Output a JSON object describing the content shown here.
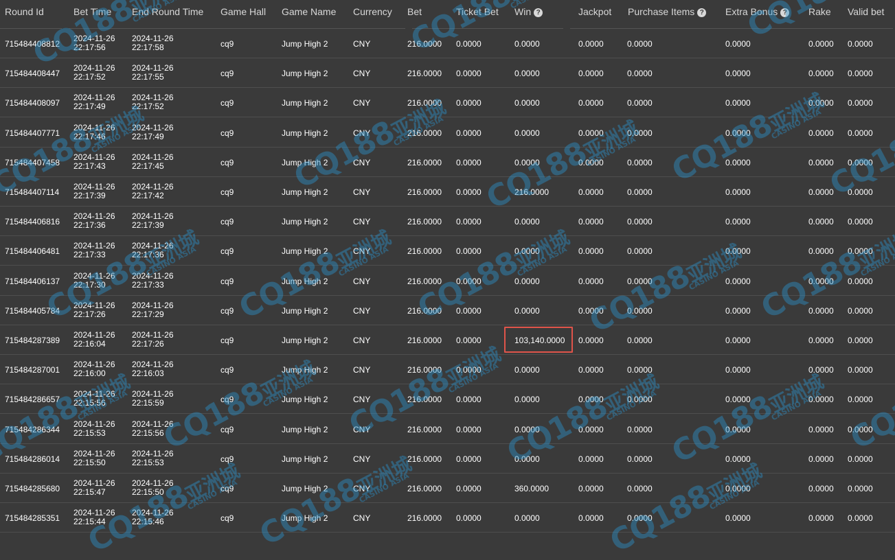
{
  "columns": [
    {
      "label": "Round Id",
      "help": false
    },
    {
      "label": "Bet Time",
      "help": false
    },
    {
      "label": "End Round Time",
      "help": false
    },
    {
      "label": "Game Hall",
      "help": false
    },
    {
      "label": "Game Name",
      "help": false
    },
    {
      "label": "Currency",
      "help": false
    },
    {
      "label": "Bet",
      "help": false
    },
    {
      "label": "Ticket Bet",
      "help": false
    },
    {
      "label": "Win",
      "help": true
    },
    {
      "label": "Jackpot",
      "help": false
    },
    {
      "label": "Purchase Items",
      "help": true
    },
    {
      "label": "Extra Bonus",
      "help": true
    },
    {
      "label": "Rake",
      "help": false
    },
    {
      "label": "Valid bet",
      "help": false
    }
  ],
  "help_glyph": "?",
  "rows": [
    {
      "round_id": "715484408812",
      "bet_date": "2024-11-26",
      "bet_time": "22:17:56",
      "end_date": "2024-11-26",
      "end_time": "22:17:58",
      "hall": "cq9",
      "game": "Jump High 2",
      "currency": "CNY",
      "bet": "216.0000",
      "ticket_bet": "0.0000",
      "win": "0.0000",
      "jackpot": "0.0000",
      "purchase": "0.0000",
      "extra_bonus": "0.0000",
      "rake": "0.0000",
      "valid_bet": "0.0000"
    },
    {
      "round_id": "715484408447",
      "bet_date": "2024-11-26",
      "bet_time": "22:17:52",
      "end_date": "2024-11-26",
      "end_time": "22:17:55",
      "hall": "cq9",
      "game": "Jump High 2",
      "currency": "CNY",
      "bet": "216.0000",
      "ticket_bet": "0.0000",
      "win": "0.0000",
      "jackpot": "0.0000",
      "purchase": "0.0000",
      "extra_bonus": "0.0000",
      "rake": "0.0000",
      "valid_bet": "0.0000"
    },
    {
      "round_id": "715484408097",
      "bet_date": "2024-11-26",
      "bet_time": "22:17:49",
      "end_date": "2024-11-26",
      "end_time": "22:17:52",
      "hall": "cq9",
      "game": "Jump High 2",
      "currency": "CNY",
      "bet": "216.0000",
      "ticket_bet": "0.0000",
      "win": "0.0000",
      "jackpot": "0.0000",
      "purchase": "0.0000",
      "extra_bonus": "0.0000",
      "rake": "0.0000",
      "valid_bet": "0.0000"
    },
    {
      "round_id": "715484407771",
      "bet_date": "2024-11-26",
      "bet_time": "22:17:46",
      "end_date": "2024-11-26",
      "end_time": "22:17:49",
      "hall": "cq9",
      "game": "Jump High 2",
      "currency": "CNY",
      "bet": "216.0000",
      "ticket_bet": "0.0000",
      "win": "0.0000",
      "jackpot": "0.0000",
      "purchase": "0.0000",
      "extra_bonus": "0.0000",
      "rake": "0.0000",
      "valid_bet": "0.0000"
    },
    {
      "round_id": "715484407458",
      "bet_date": "2024-11-26",
      "bet_time": "22:17:43",
      "end_date": "2024-11-26",
      "end_time": "22:17:45",
      "hall": "cq9",
      "game": "Jump High 2",
      "currency": "CNY",
      "bet": "216.0000",
      "ticket_bet": "0.0000",
      "win": "0.0000",
      "jackpot": "0.0000",
      "purchase": "0.0000",
      "extra_bonus": "0.0000",
      "rake": "0.0000",
      "valid_bet": "0.0000"
    },
    {
      "round_id": "715484407114",
      "bet_date": "2024-11-26",
      "bet_time": "22:17:39",
      "end_date": "2024-11-26",
      "end_time": "22:17:42",
      "hall": "cq9",
      "game": "Jump High 2",
      "currency": "CNY",
      "bet": "216.0000",
      "ticket_bet": "0.0000",
      "win": "216.0000",
      "jackpot": "0.0000",
      "purchase": "0.0000",
      "extra_bonus": "0.0000",
      "rake": "0.0000",
      "valid_bet": "0.0000"
    },
    {
      "round_id": "715484406816",
      "bet_date": "2024-11-26",
      "bet_time": "22:17:36",
      "end_date": "2024-11-26",
      "end_time": "22:17:39",
      "hall": "cq9",
      "game": "Jump High 2",
      "currency": "CNY",
      "bet": "216.0000",
      "ticket_bet": "0.0000",
      "win": "0.0000",
      "jackpot": "0.0000",
      "purchase": "0.0000",
      "extra_bonus": "0.0000",
      "rake": "0.0000",
      "valid_bet": "0.0000"
    },
    {
      "round_id": "715484406481",
      "bet_date": "2024-11-26",
      "bet_time": "22:17:33",
      "end_date": "2024-11-26",
      "end_time": "22:17:36",
      "hall": "cq9",
      "game": "Jump High 2",
      "currency": "CNY",
      "bet": "216.0000",
      "ticket_bet": "0.0000",
      "win": "0.0000",
      "jackpot": "0.0000",
      "purchase": "0.0000",
      "extra_bonus": "0.0000",
      "rake": "0.0000",
      "valid_bet": "0.0000"
    },
    {
      "round_id": "715484406137",
      "bet_date": "2024-11-26",
      "bet_time": "22:17:30",
      "end_date": "2024-11-26",
      "end_time": "22:17:33",
      "hall": "cq9",
      "game": "Jump High 2",
      "currency": "CNY",
      "bet": "216.0000",
      "ticket_bet": "0.0000",
      "win": "0.0000",
      "jackpot": "0.0000",
      "purchase": "0.0000",
      "extra_bonus": "0.0000",
      "rake": "0.0000",
      "valid_bet": "0.0000"
    },
    {
      "round_id": "715484405784",
      "bet_date": "2024-11-26",
      "bet_time": "22:17:26",
      "end_date": "2024-11-26",
      "end_time": "22:17:29",
      "hall": "cq9",
      "game": "Jump High 2",
      "currency": "CNY",
      "bet": "216.0000",
      "ticket_bet": "0.0000",
      "win": "0.0000",
      "jackpot": "0.0000",
      "purchase": "0.0000",
      "extra_bonus": "0.0000",
      "rake": "0.0000",
      "valid_bet": "0.0000"
    },
    {
      "round_id": "715484287389",
      "bet_date": "2024-11-26",
      "bet_time": "22:16:04",
      "end_date": "2024-11-26",
      "end_time": "22:17:26",
      "hall": "cq9",
      "game": "Jump High 2",
      "currency": "CNY",
      "bet": "216.0000",
      "ticket_bet": "0.0000",
      "win": "103,140.0000",
      "jackpot": "0.0000",
      "purchase": "0.0000",
      "extra_bonus": "0.0000",
      "rake": "0.0000",
      "valid_bet": "0.0000"
    },
    {
      "round_id": "715484287001",
      "bet_date": "2024-11-26",
      "bet_time": "22:16:00",
      "end_date": "2024-11-26",
      "end_time": "22:16:03",
      "hall": "cq9",
      "game": "Jump High 2",
      "currency": "CNY",
      "bet": "216.0000",
      "ticket_bet": "0.0000",
      "win": "0.0000",
      "jackpot": "0.0000",
      "purchase": "0.0000",
      "extra_bonus": "0.0000",
      "rake": "0.0000",
      "valid_bet": "0.0000"
    },
    {
      "round_id": "715484286657",
      "bet_date": "2024-11-26",
      "bet_time": "22:15:56",
      "end_date": "2024-11-26",
      "end_time": "22:15:59",
      "hall": "cq9",
      "game": "Jump High 2",
      "currency": "CNY",
      "bet": "216.0000",
      "ticket_bet": "0.0000",
      "win": "0.0000",
      "jackpot": "0.0000",
      "purchase": "0.0000",
      "extra_bonus": "0.0000",
      "rake": "0.0000",
      "valid_bet": "0.0000"
    },
    {
      "round_id": "715484286344",
      "bet_date": "2024-11-26",
      "bet_time": "22:15:53",
      "end_date": "2024-11-26",
      "end_time": "22:15:56",
      "hall": "cq9",
      "game": "Jump High 2",
      "currency": "CNY",
      "bet": "216.0000",
      "ticket_bet": "0.0000",
      "win": "0.0000",
      "jackpot": "0.0000",
      "purchase": "0.0000",
      "extra_bonus": "0.0000",
      "rake": "0.0000",
      "valid_bet": "0.0000"
    },
    {
      "round_id": "715484286014",
      "bet_date": "2024-11-26",
      "bet_time": "22:15:50",
      "end_date": "2024-11-26",
      "end_time": "22:15:53",
      "hall": "cq9",
      "game": "Jump High 2",
      "currency": "CNY",
      "bet": "216.0000",
      "ticket_bet": "0.0000",
      "win": "0.0000",
      "jackpot": "0.0000",
      "purchase": "0.0000",
      "extra_bonus": "0.0000",
      "rake": "0.0000",
      "valid_bet": "0.0000"
    },
    {
      "round_id": "715484285680",
      "bet_date": "2024-11-26",
      "bet_time": "22:15:47",
      "end_date": "2024-11-26",
      "end_time": "22:15:50",
      "hall": "cq9",
      "game": "Jump High 2",
      "currency": "CNY",
      "bet": "216.0000",
      "ticket_bet": "0.0000",
      "win": "360.0000",
      "jackpot": "0.0000",
      "purchase": "0.0000",
      "extra_bonus": "0.0000",
      "rake": "0.0000",
      "valid_bet": "0.0000"
    },
    {
      "round_id": "715484285351",
      "bet_date": "2024-11-26",
      "bet_time": "22:15:44",
      "end_date": "2024-11-26",
      "end_time": "22:15:46",
      "hall": "cq9",
      "game": "Jump High 2",
      "currency": "CNY",
      "bet": "216.0000",
      "ticket_bet": "0.0000",
      "win": "0.0000",
      "jackpot": "0.0000",
      "purchase": "0.0000",
      "extra_bonus": "0.0000",
      "rake": "0.0000",
      "valid_bet": "0.0000"
    }
  ],
  "watermark": {
    "brand": "CQ188",
    "cjk": "亚洲城",
    "sub": "CASINO ASIA"
  },
  "colors": {
    "background": "#3a3a3a",
    "text": "#ffffff",
    "header_text": "#d8d8d8",
    "row_divider": "#4e4e4e",
    "highlight_box": "#e0544a",
    "watermark": "#2c96d2"
  }
}
